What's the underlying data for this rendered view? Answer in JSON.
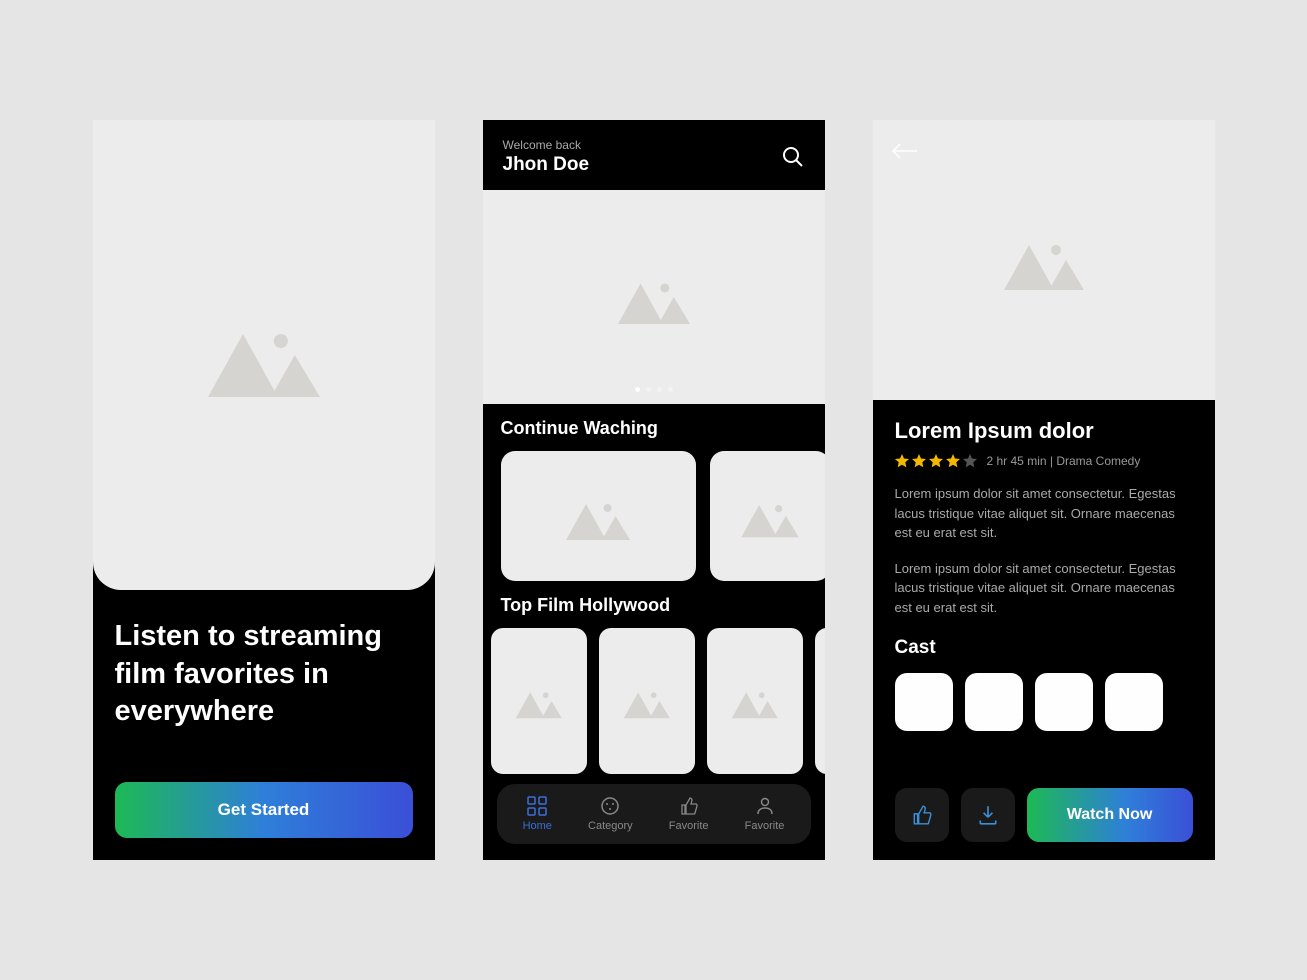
{
  "screen1": {
    "title": "Listen to streaming film favorites in everywhere",
    "cta": "Get Started"
  },
  "screen2": {
    "welcome": "Welcome back",
    "username": "Jhon Doe",
    "continue_title": "Continue Waching",
    "topfilm_title": "Top Film Hollywood",
    "nav": {
      "home": "Home",
      "category": "Category",
      "favorite1": "Favorite",
      "favorite2": "Favorite"
    }
  },
  "screen3": {
    "title": "Lorem Ipsum dolor",
    "duration_genre": "2 hr 45 min | Drama Comedy",
    "rating": 4,
    "desc1": "Lorem ipsum dolor sit amet consectetur. Egestas lacus tristique vitae aliquet sit. Ornare maecenas est eu erat est sit.",
    "desc2": "Lorem ipsum dolor sit amet consectetur. Egestas lacus tristique vitae aliquet sit. Ornare maecenas est eu erat est sit.",
    "cast_title": "Cast",
    "watch": "Watch Now"
  }
}
